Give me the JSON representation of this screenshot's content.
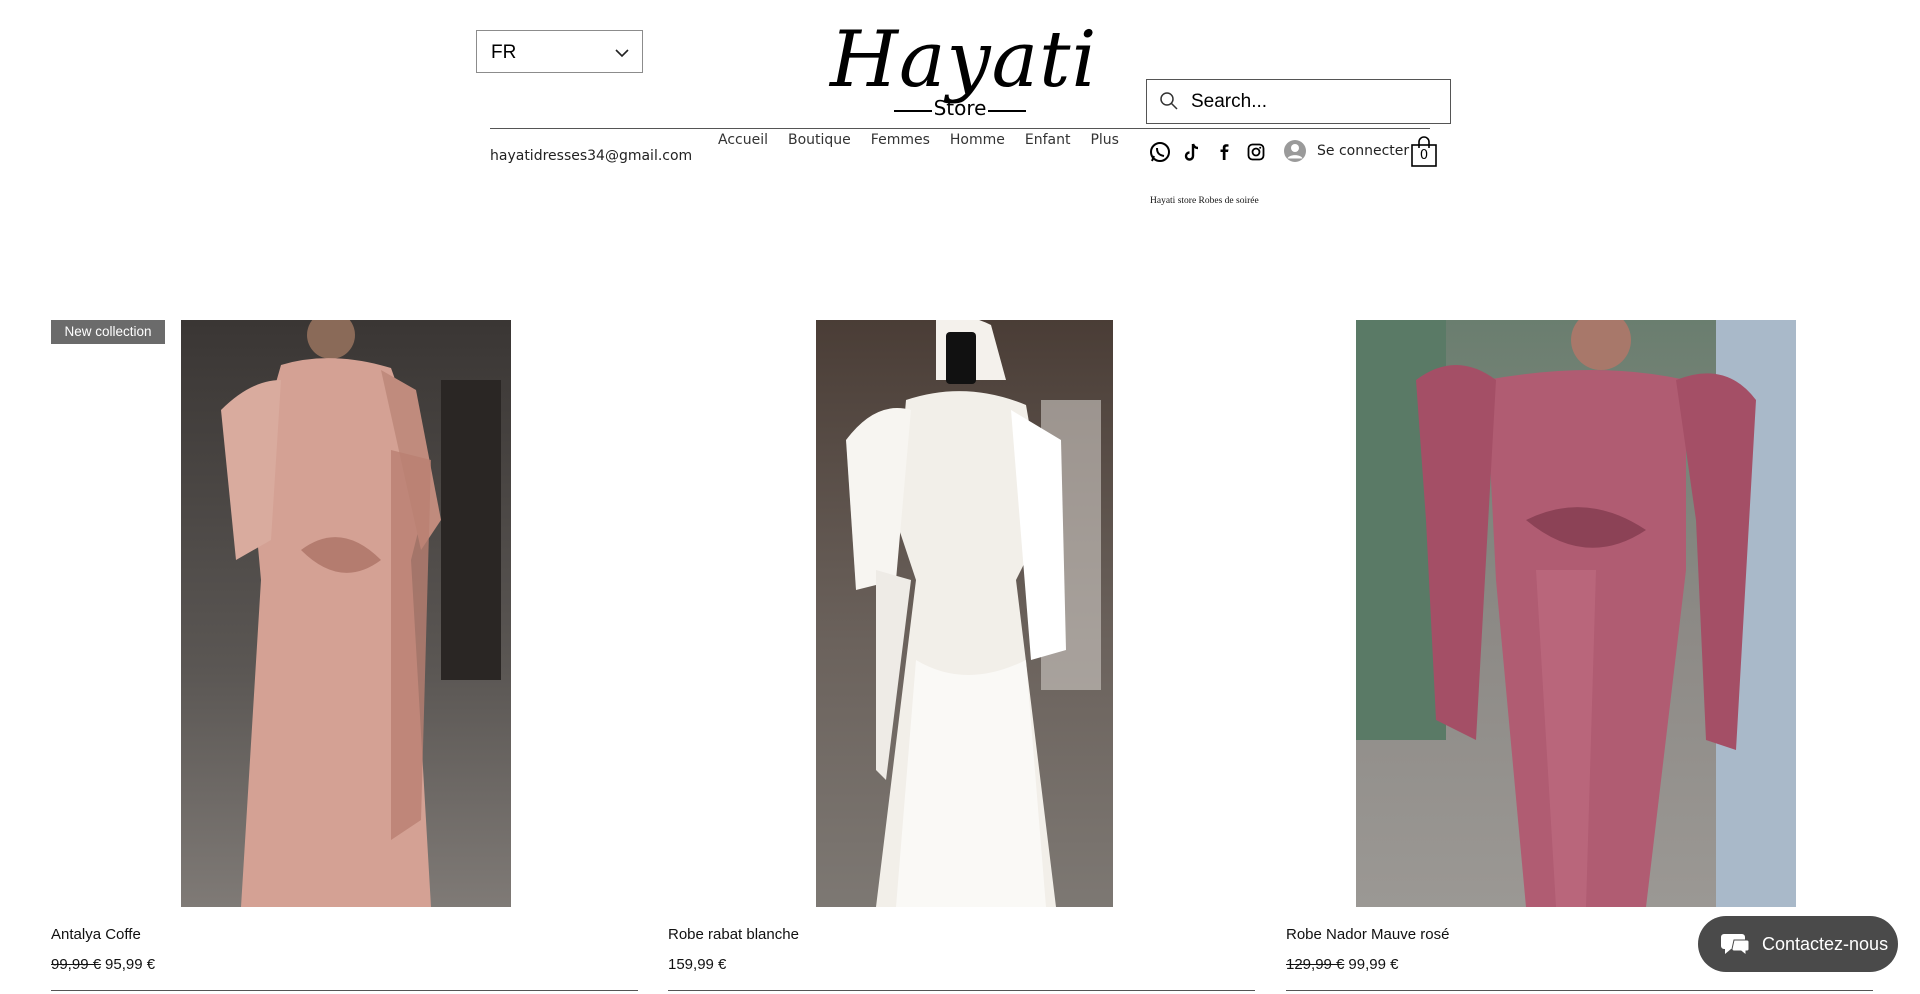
{
  "header": {
    "language": "FR",
    "logo": {
      "script": "Hayati",
      "sub": "Store"
    },
    "search": {
      "placeholder": "Search..."
    },
    "email": "hayatidresses34@gmail.com",
    "nav": [
      "Accueil",
      "Boutique",
      "Femmes",
      "Homme",
      "Enfant",
      "Plus"
    ],
    "social_icons": [
      "whatsapp-icon",
      "tiktok-icon",
      "facebook-icon",
      "instagram-icon"
    ],
    "login_label": "Se connecter",
    "cart_count": "0",
    "tagline": "Hayati store Robes de soirée"
  },
  "products": [
    {
      "name": "Antalya Coffe",
      "old_price": "99,99 €",
      "price": "95,99 €",
      "badge": "New collection",
      "dress_color": "#d4a194"
    },
    {
      "name": "Robe rabat blanche",
      "old_price": "",
      "price": "159,99 €",
      "badge": "",
      "dress_color": "#f2efe9"
    },
    {
      "name": "Robe Nador Mauve rosé",
      "old_price": "129,99 €",
      "price": "99,99 €",
      "badge": "",
      "dress_color": "#b05c72"
    }
  ],
  "chat": {
    "label": "Contactez-nous"
  }
}
